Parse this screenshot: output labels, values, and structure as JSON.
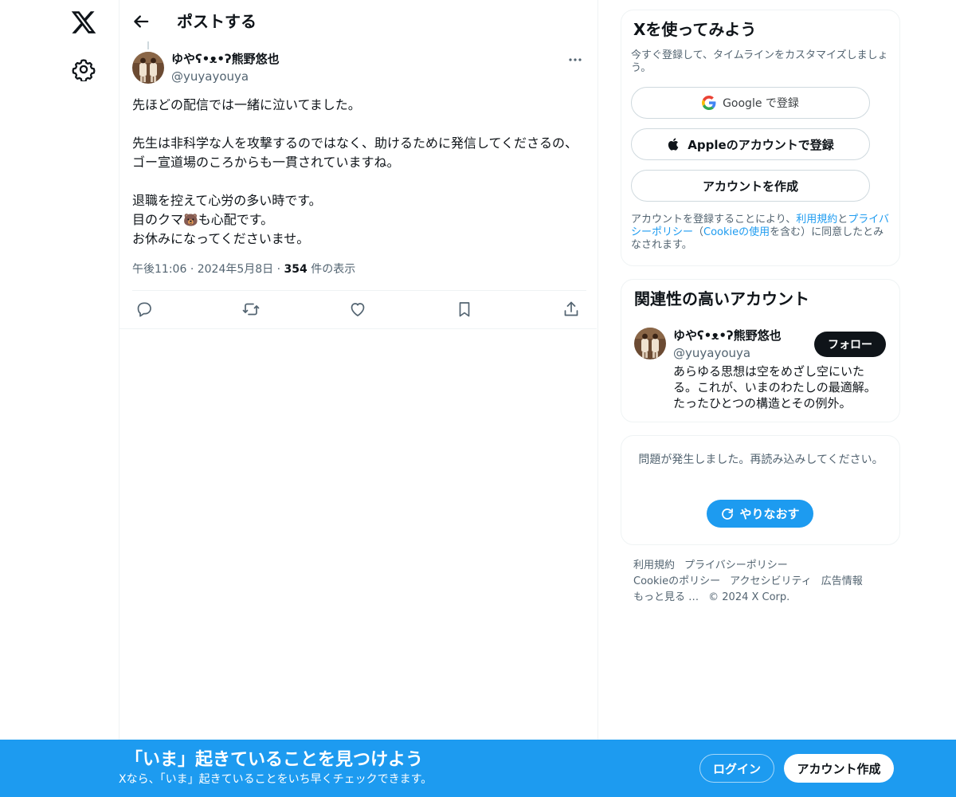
{
  "header": {
    "title": "ポストする"
  },
  "post": {
    "author_name": "ゆやʕ•ᴥ•ʔ熊野悠也",
    "author_handle": "@yuyayouya",
    "paragraphs": [
      [
        "先ほどの配信では一緒に泣いてました。"
      ],
      [
        "先生は非科学な人を攻撃するのではなく、助けるために発信してくださるの、ゴー宣道場のころからも一貫されていますね。"
      ]
    ],
    "line_retire": "退職を控えて心労の多い時です。",
    "line_kuma_before": "目のクマ",
    "bear_emoji": "🐻",
    "line_kuma_after": "も心配です。",
    "line_rest": "お休みになってくださいませ。",
    "time": "午後11:06",
    "separator": "·",
    "date": "2024年5月8日",
    "views_count": "354",
    "views_label": "件の表示"
  },
  "signup_card": {
    "title": "Xを使ってみよう",
    "subtitle": "今すぐ登録して、タイムラインをカスタマイズしましょう。",
    "google_label": "Google で登録",
    "apple_label": "Appleのアカウントで登録",
    "create_label": "アカウントを作成",
    "terms_prefix": "アカウントを登録することにより、",
    "terms_link": "利用規約",
    "terms_and": "と",
    "privacy_link": "プライバシーポリシー",
    "terms_paren_open": "（",
    "cookie_link": "Cookieの使用",
    "terms_suffix": "を含む）に同意したとみなされます。"
  },
  "related": {
    "title": "関連性の高いアカウント",
    "name": "ゆやʕ•ᴥ•ʔ熊野悠也",
    "handle": "@yuyayouya",
    "follow_label": "フォロー",
    "bio": "あらゆる思想は空をめざし空にいたる。これが、いまのわたしの最適解。たったひとつの構造とその例外。"
  },
  "error_card": {
    "message": "問題が発生しました。再読み込みしてください。",
    "retry_label": "やりなおす"
  },
  "footer": {
    "terms": "利用規約",
    "privacy": "プライバシーポリシー",
    "cookie": "Cookieのポリシー",
    "accessibility": "アクセシビリティ",
    "ads": "広告情報",
    "more": "もっと見る …",
    "copyright": "© 2024 X Corp."
  },
  "bottom_bar": {
    "title": "「いま」起きていることを見つけよう",
    "subtitle": "Xなら、「いま」起きていることをいち早くチェックできます。",
    "login_label": "ログイン",
    "signup_label": "アカウント作成"
  },
  "icons": {
    "logo": "x-logo-icon",
    "settings": "gear-icon",
    "back": "arrow-left-icon",
    "more": "more-horizontal-icon",
    "reply": "reply-icon",
    "repost": "repost-icon",
    "like": "heart-icon",
    "bookmark": "bookmark-icon",
    "share": "share-icon",
    "google": "google-icon",
    "apple": "apple-icon",
    "refresh": "refresh-icon"
  },
  "colors": {
    "accent": "#1d9bf0",
    "text": "#0f1419",
    "muted": "#536471",
    "border": "#eff3f4"
  }
}
